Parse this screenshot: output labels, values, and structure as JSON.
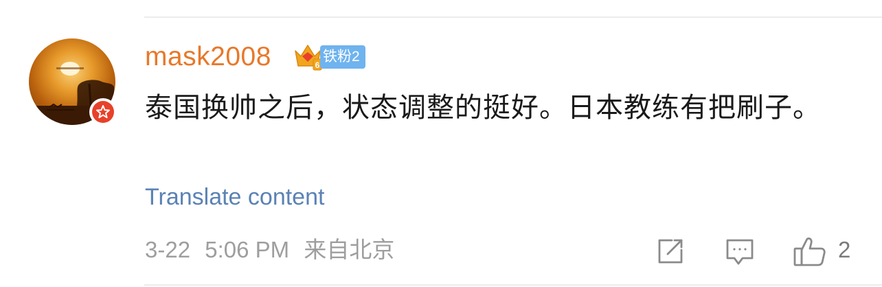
{
  "comment": {
    "username": "mask2008",
    "badges": {
      "crown_icon": "crown-icon",
      "crown_level": "6",
      "fan_badge": "铁粉2",
      "colors": {
        "crown": "#f2a51e",
        "fan_badge_bg": "#6fb3ef"
      }
    },
    "avatar": {
      "icon": "sunset-avatar",
      "verify_icon": "verified-star-icon",
      "verify_color": "#e8412a"
    },
    "text": "泰国换帅之后，状态调整的挺好。日本教练有把刷子。",
    "translate_label": "Translate content",
    "meta": {
      "date": "3-22",
      "time": "5:06 PM",
      "location": "来自北京"
    },
    "actions": {
      "repost_icon": "repost-icon",
      "reply_icon": "comment-icon",
      "like_icon": "thumbs-up-icon",
      "like_count": "2"
    },
    "colors": {
      "username": "#e8782a",
      "link": "#5b82b4",
      "meta": "#9e9e9e"
    }
  }
}
